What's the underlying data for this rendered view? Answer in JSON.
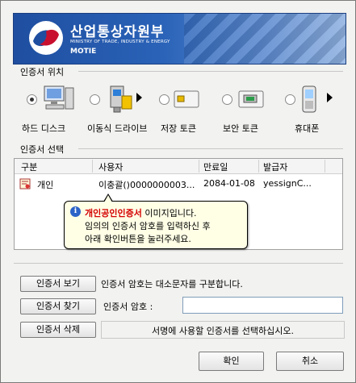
{
  "banner": {
    "org_name": "산업통상자원부",
    "org_english": "MINISTRY OF TRADE, INDUSTRY & ENERGY",
    "org_abbr": "MOTIE"
  },
  "location": {
    "section_title": "인증서 위치",
    "items": [
      {
        "label": "하드 디스크",
        "icon": "computer-icon",
        "selected": true
      },
      {
        "label": "이동식 드라이브",
        "icon": "usb-drive-icon",
        "selected": false
      },
      {
        "label": "저장 토큰",
        "icon": "storage-token-icon",
        "selected": false
      },
      {
        "label": "보안 토큰",
        "icon": "security-token-icon",
        "selected": false
      },
      {
        "label": "휴대폰",
        "icon": "mobile-phone-icon",
        "selected": false
      }
    ]
  },
  "selection": {
    "section_title": "인증서 선택",
    "columns": [
      "구분",
      "사용자",
      "만료일",
      "발급자"
    ],
    "rows": [
      {
        "type": "개인",
        "user": "이충괄()0000000003...",
        "expiry": "2084-01-08",
        "issuer": "yessignC..."
      }
    ]
  },
  "tooltip": {
    "highlight": "개인공인인증서",
    "line1_rest": " 이미지입니다.",
    "line2": "임의의 인증서 암호를 입력하신 후",
    "line3": "아래 확인버튼을 눌러주세요."
  },
  "actions": {
    "view_cert": "인증서 보기",
    "find_cert": "인증서 찾기",
    "delete_cert": "인증서 삭제",
    "case_note": "인증서 암호는 대소문자를 구분합니다.",
    "password_label": "인증서 암호 :",
    "password_value": "",
    "status": "서명에 사용할 인증서를 선택하십시오.",
    "ok": "확인",
    "cancel": "취소"
  },
  "colors": {
    "banner": "#2a63b8",
    "tooltip_bg": "#ffffe6",
    "highlight": "#d40000"
  }
}
